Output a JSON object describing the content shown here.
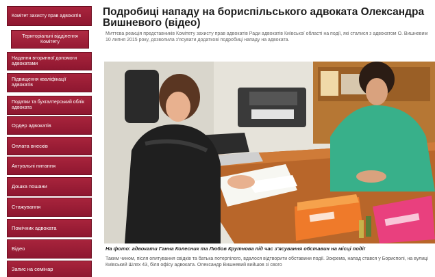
{
  "sidebar": {
    "items": [
      {
        "label": "Комітет захисту прав адвокатів"
      },
      {
        "label": "Територіальні відділення Комітету"
      },
      {
        "label": "Надання вторинної допомоги адвокатами"
      },
      {
        "label": "Підвищення кваліфікації адвокатів"
      },
      {
        "label": "Податки та бухгалтерський облік адвоката"
      },
      {
        "label": "Ордер адвокатів"
      },
      {
        "label": "Оплата внесків"
      },
      {
        "label": "Актуальні питання"
      },
      {
        "label": "Дошка пошани"
      },
      {
        "label": "Стажування"
      },
      {
        "label": "Помічник адвоката"
      },
      {
        "label": "Відео"
      },
      {
        "label": "Запис на семінар"
      }
    ]
  },
  "article": {
    "title": "Подробиці нападу на бориспільського адвоката Олександра Вишневого (відео)",
    "intro": "Миттєва реакція представників Комітету захисту прав адвокатів Ради адвокатів Київської області на події, які сталися з адвокатом О. Вишневим 10 липня 2015 року, дозволила з'ясувати додаткові подробиці нападу на адвоката.",
    "caption": "На фото: адвокати Ганна Колесник та Любов Крутнова під час з'ясування обставин на місці події",
    "body": "Таким чином, після опитування свідків та батька потерпілого, вдалося відтворити обставини події. Зокрема, напад стався у Борисполі, на вулиці Київський Шлях 43, біля офісу адвоката. Олександр Вишневий вийшов зі свого"
  }
}
